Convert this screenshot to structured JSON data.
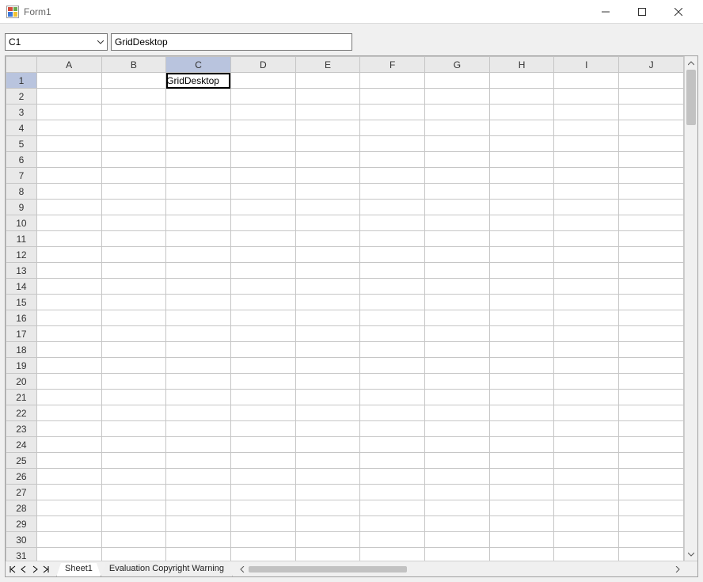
{
  "window": {
    "title": "Form1"
  },
  "namebox": {
    "value": "C1"
  },
  "formula": {
    "value": "GridDesktop"
  },
  "grid": {
    "columns": [
      "A",
      "B",
      "C",
      "D",
      "E",
      "F",
      "G",
      "H",
      "I",
      "J"
    ],
    "row_start": 1,
    "row_end": 31,
    "active_cell": {
      "col": "C",
      "row": 1
    },
    "cells": {
      "C1": "GridDesktop"
    }
  },
  "tabs": {
    "items": [
      "Sheet1",
      "Evaluation Copyright Warning"
    ],
    "active_index": 0
  }
}
